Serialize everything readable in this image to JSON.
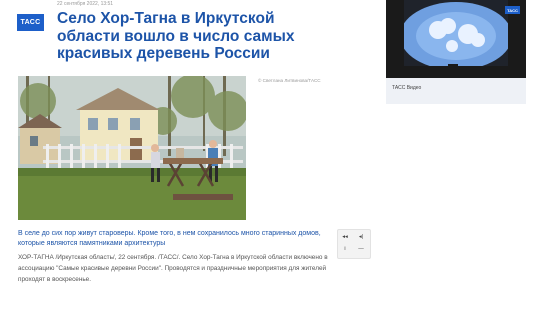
{
  "logo": {
    "text": "ТАСС"
  },
  "article": {
    "meta": "22 сентября 2022, 13:51",
    "headline": "Село Хор-Тагна в Иркутской области вошло в число самых красивых деревень России",
    "photo_credit": "© Светлана Литвинова/ТАСС",
    "caption": "В селе до сих пор живут староверы. Кроме того, в нем сохранилось много старинных домов, которые являются памятниками архитектуры",
    "body": "ХОР-ТАГНА /Иркутская область/, 22 сентября. /ТАСС/. Село Хор-Тагна в Иркутской области включено в ассоциацию \"Самые красивые деревни России\". Проводятся и праздничные мероприятия для жителей проходят в воскресенье."
  },
  "sidebar": {
    "badge": "ТАСС",
    "video_label": "ТАСС Видео"
  },
  "controls": {
    "icons": [
      "rewind-icon",
      "play-pause-icon",
      "info-icon",
      "minus-icon"
    ],
    "glyphs": [
      "◂◂",
      "◂|",
      "i",
      "—"
    ]
  },
  "colors": {
    "accent": "#1d54a8",
    "logo_bg": "#1d5fc9",
    "meta_gray": "#9a9a9a"
  }
}
